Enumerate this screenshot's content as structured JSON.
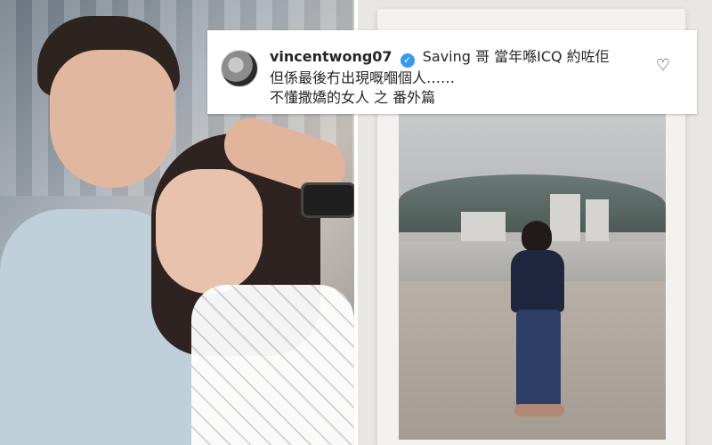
{
  "comment": {
    "username": "vincentwong07",
    "line1_text": "Saving 哥 當年喺ICQ 約咗佢",
    "line2": "但係最後冇出現嘅嗰個人……",
    "line3": "不懂撒嬌的女人 之 番外篇",
    "verified_glyph": "✓",
    "heart_glyph": "♡",
    "avatar_icon": "profile-avatar",
    "colors": {
      "text": "#262626",
      "verified": "#3897f0",
      "box": "#ffffff"
    }
  },
  "icons": {
    "like": "heart-outline-icon",
    "verified": "verified-badge-icon"
  }
}
